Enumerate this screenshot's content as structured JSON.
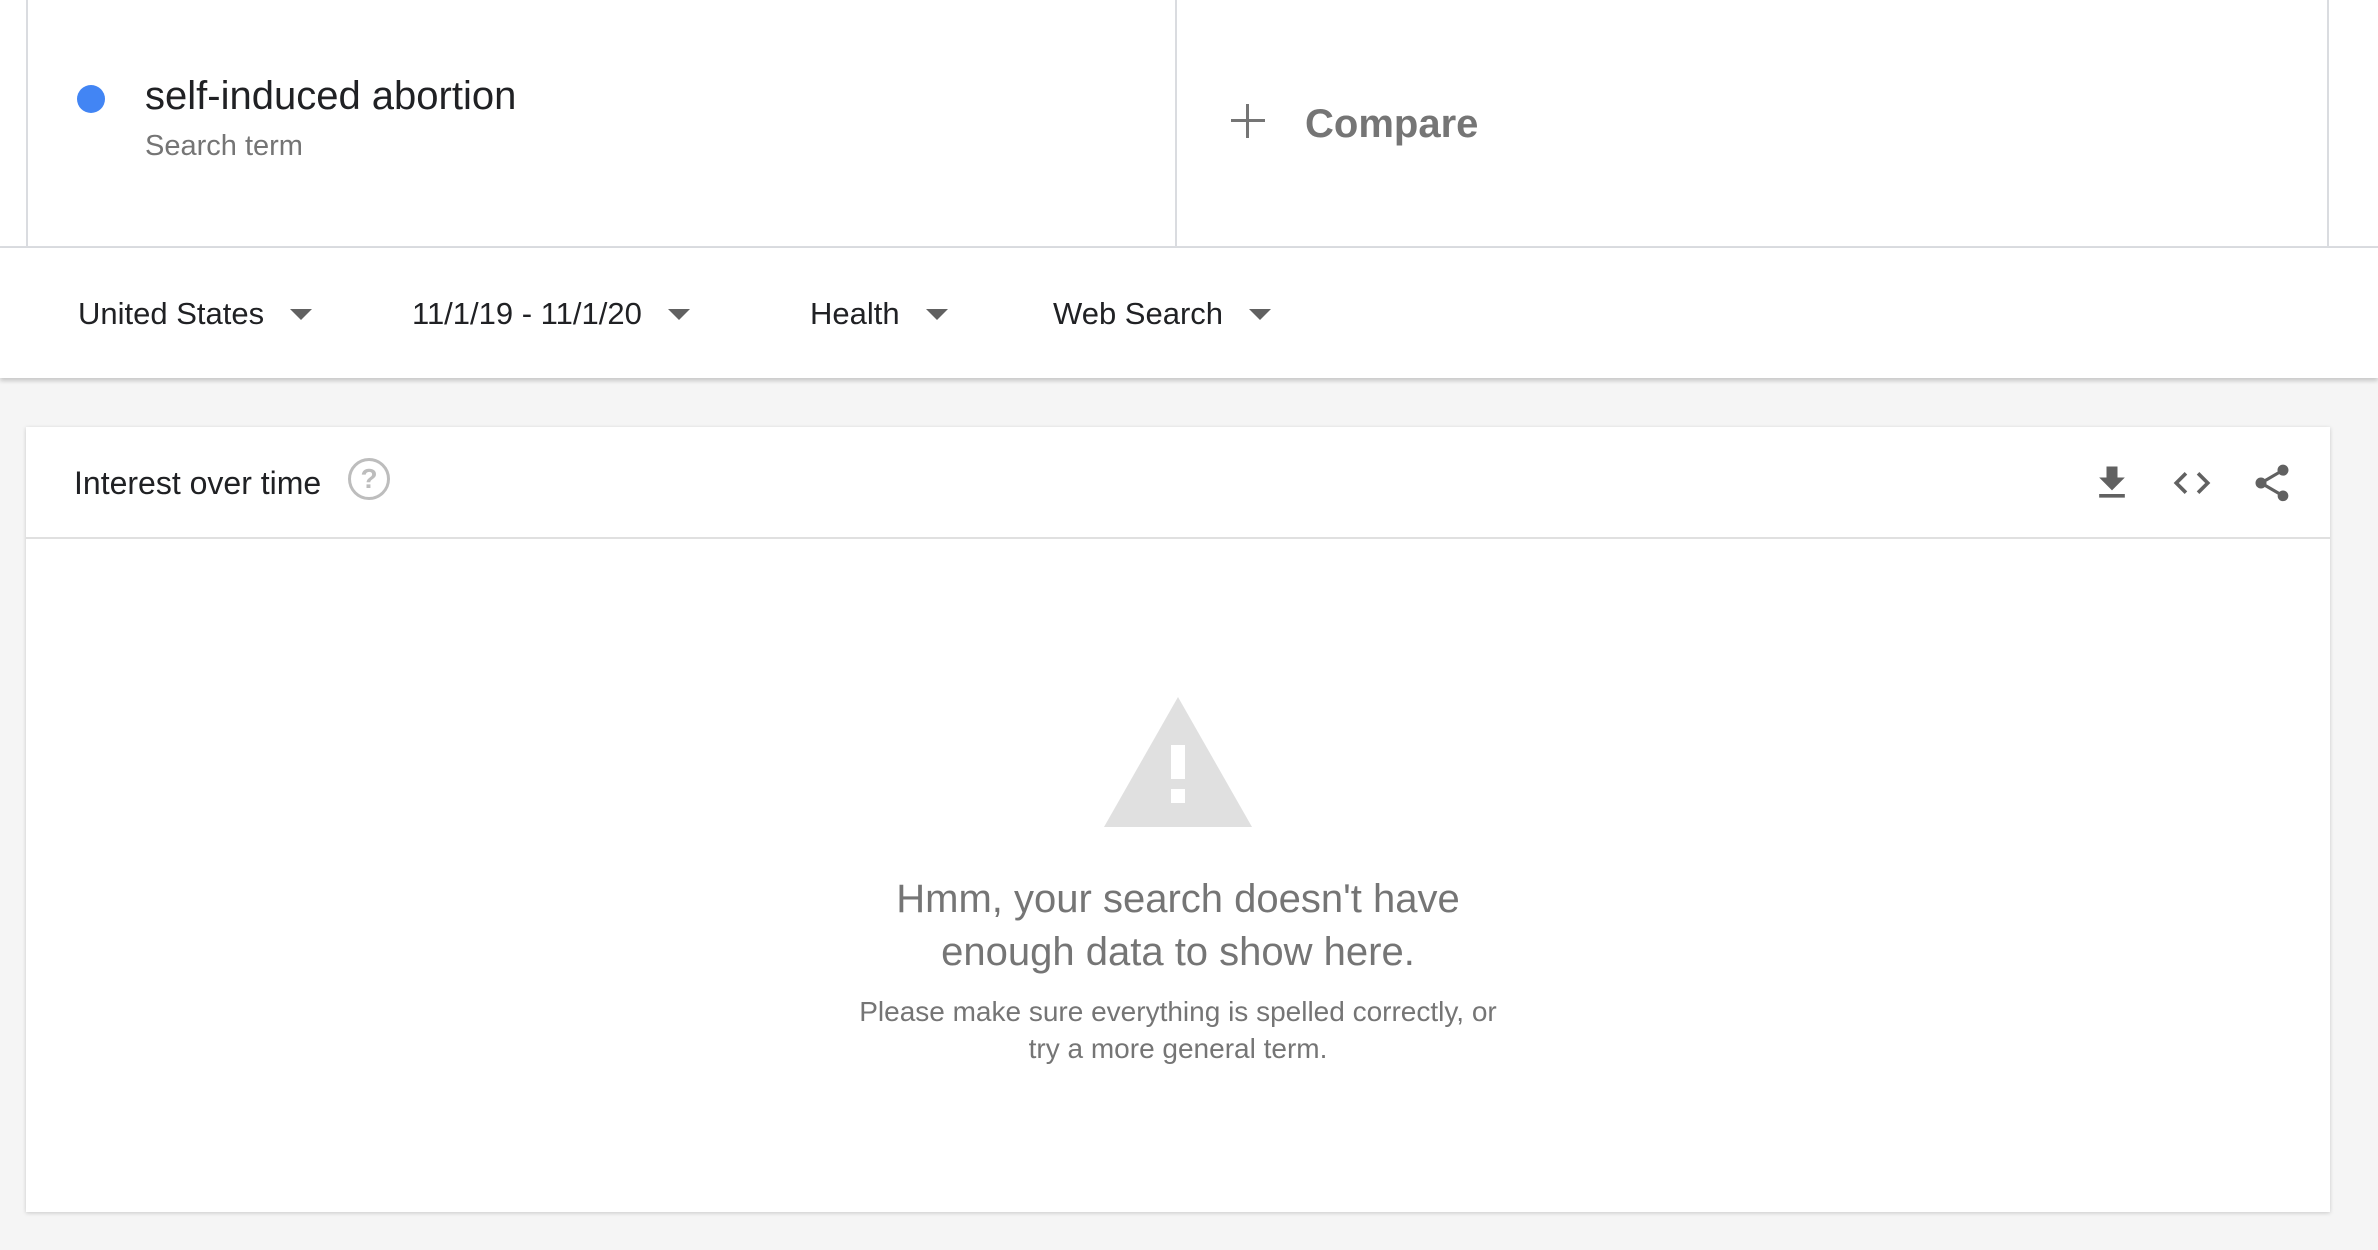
{
  "term": {
    "name": "self-induced abortion",
    "type": "Search term",
    "color": "#4285f4"
  },
  "compare": {
    "label": "Compare",
    "icon": "plus-icon"
  },
  "filters": [
    {
      "label": "United States",
      "icon": "caret-down-icon"
    },
    {
      "label": "11/1/19 - 11/1/20",
      "icon": "caret-down-icon"
    },
    {
      "label": "Health",
      "icon": "caret-down-icon"
    },
    {
      "label": "Web Search",
      "icon": "caret-down-icon"
    }
  ],
  "interest_card": {
    "title": "Interest over time",
    "help_glyph": "?",
    "actions": [
      "download-icon",
      "embed-code-icon",
      "share-icon"
    ],
    "empty_state": {
      "icon": "warning-icon",
      "title_line1": "Hmm, your search doesn't have",
      "title_line2": "enough data to show here.",
      "sub_line1": "Please make sure everything is spelled correctly, or",
      "sub_line2": "try a more general term."
    }
  }
}
